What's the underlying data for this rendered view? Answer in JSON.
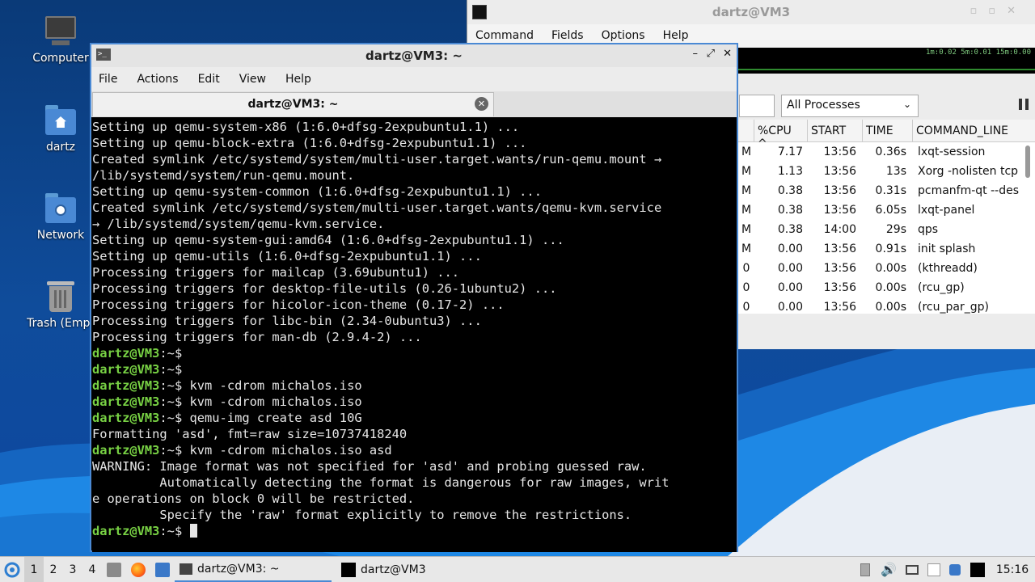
{
  "desktop": {
    "icons": [
      {
        "label": "Computer",
        "icon": "computer-icon"
      },
      {
        "label": "dartz",
        "icon": "home-folder-icon"
      },
      {
        "label": "Network",
        "icon": "network-folder-icon"
      },
      {
        "label": "Trash (Empt",
        "icon": "trash-icon"
      }
    ]
  },
  "qps": {
    "title": "dartz@VM3",
    "menu": [
      "Command",
      "Fields",
      "Options",
      "Help"
    ],
    "load": "1m:0.02 5m:0.01 15m:0.00",
    "filter_select": "All Processes",
    "columns": [
      "%CPU",
      "START",
      "TIME",
      "COMMAND_LINE"
    ],
    "sort_indicator": "^",
    "rows": [
      {
        "mem": "M",
        "cpu": "7.17",
        "start": "13:56",
        "time": "0.36s",
        "cmd": "lxqt-session"
      },
      {
        "mem": "M",
        "cpu": "1.13",
        "start": "13:56",
        "time": "13s",
        "cmd": "Xorg -nolisten tcp"
      },
      {
        "mem": "M",
        "cpu": "0.38",
        "start": "13:56",
        "time": "0.31s",
        "cmd": "pcmanfm-qt --des"
      },
      {
        "mem": "M",
        "cpu": "0.38",
        "start": "13:56",
        "time": "6.05s",
        "cmd": "lxqt-panel"
      },
      {
        "mem": "M",
        "cpu": "0.38",
        "start": "14:00",
        "time": "29s",
        "cmd": "qps"
      },
      {
        "mem": "M",
        "cpu": "0.00",
        "start": "13:56",
        "time": "0.91s",
        "cmd": "init splash"
      },
      {
        "mem": "0",
        "cpu": "0.00",
        "start": "13:56",
        "time": "0.00s",
        "cmd": "(kthreadd)"
      },
      {
        "mem": "0",
        "cpu": "0.00",
        "start": "13:56",
        "time": "0.00s",
        "cmd": "(rcu_gp)"
      },
      {
        "mem": "0",
        "cpu": "0.00",
        "start": "13:56",
        "time": "0.00s",
        "cmd": "(rcu_par_gp)"
      }
    ]
  },
  "terminal": {
    "title": "dartz@VM3: ~",
    "menu": [
      "File",
      "Actions",
      "Edit",
      "View",
      "Help"
    ],
    "tab_label": "dartz@VM3: ~",
    "prompt": "dartz@VM3",
    "prompt_path": ":~$",
    "lines": [
      {
        "type": "out",
        "text": "Setting up qemu-system-x86 (1:6.0+dfsg-2expubuntu1.1) ..."
      },
      {
        "type": "out",
        "text": "Setting up qemu-block-extra (1:6.0+dfsg-2expubuntu1.1) ..."
      },
      {
        "type": "out",
        "text": "Created symlink /etc/systemd/system/multi-user.target.wants/run-qemu.mount →"
      },
      {
        "type": "out",
        "text": "/lib/systemd/system/run-qemu.mount."
      },
      {
        "type": "out",
        "text": "Setting up qemu-system-common (1:6.0+dfsg-2expubuntu1.1) ..."
      },
      {
        "type": "out",
        "text": "Created symlink /etc/systemd/system/multi-user.target.wants/qemu-kvm.service"
      },
      {
        "type": "out",
        "text": "→ /lib/systemd/system/qemu-kvm.service."
      },
      {
        "type": "out",
        "text": "Setting up qemu-system-gui:amd64 (1:6.0+dfsg-2expubuntu1.1) ..."
      },
      {
        "type": "out",
        "text": "Setting up qemu-utils (1:6.0+dfsg-2expubuntu1.1) ..."
      },
      {
        "type": "out",
        "text": "Processing triggers for mailcap (3.69ubuntu1) ..."
      },
      {
        "type": "out",
        "text": "Processing triggers for desktop-file-utils (0.26-1ubuntu2) ..."
      },
      {
        "type": "out",
        "text": "Processing triggers for hicolor-icon-theme (0.17-2) ..."
      },
      {
        "type": "out",
        "text": "Processing triggers for libc-bin (2.34-0ubuntu3) ..."
      },
      {
        "type": "out",
        "text": "Processing triggers for man-db (2.9.4-2) ..."
      },
      {
        "type": "cmd",
        "text": ""
      },
      {
        "type": "cmd",
        "text": ""
      },
      {
        "type": "cmd",
        "text": " kvm -cdrom michalos.iso"
      },
      {
        "type": "cmd",
        "text": " kvm -cdrom michalos.iso"
      },
      {
        "type": "cmd",
        "text": " qemu-img create asd 10G"
      },
      {
        "type": "out",
        "text": "Formatting 'asd', fmt=raw size=10737418240"
      },
      {
        "type": "cmd",
        "text": " kvm -cdrom michalos.iso asd"
      },
      {
        "type": "out",
        "text": "WARNING: Image format was not specified for 'asd' and probing guessed raw."
      },
      {
        "type": "out",
        "text": "         Automatically detecting the format is dangerous for raw images, writ"
      },
      {
        "type": "out",
        "text": "e operations on block 0 will be restricted."
      },
      {
        "type": "out",
        "text": "         Specify the 'raw' format explicitly to remove the restrictions."
      },
      {
        "type": "cmd",
        "text": " ",
        "cursor": true
      }
    ]
  },
  "taskbar": {
    "workspaces": [
      "1",
      "2",
      "3",
      "4"
    ],
    "active_workspace": "1",
    "tasks": [
      {
        "label": "dartz@VM3: ~",
        "active": true
      },
      {
        "label": "dartz@VM3",
        "active": false
      }
    ],
    "clock": "15:16"
  },
  "colors": {
    "accent": "#4a89d4",
    "prompt": "#78d144",
    "desktop_bg": "#0f4c9b"
  }
}
